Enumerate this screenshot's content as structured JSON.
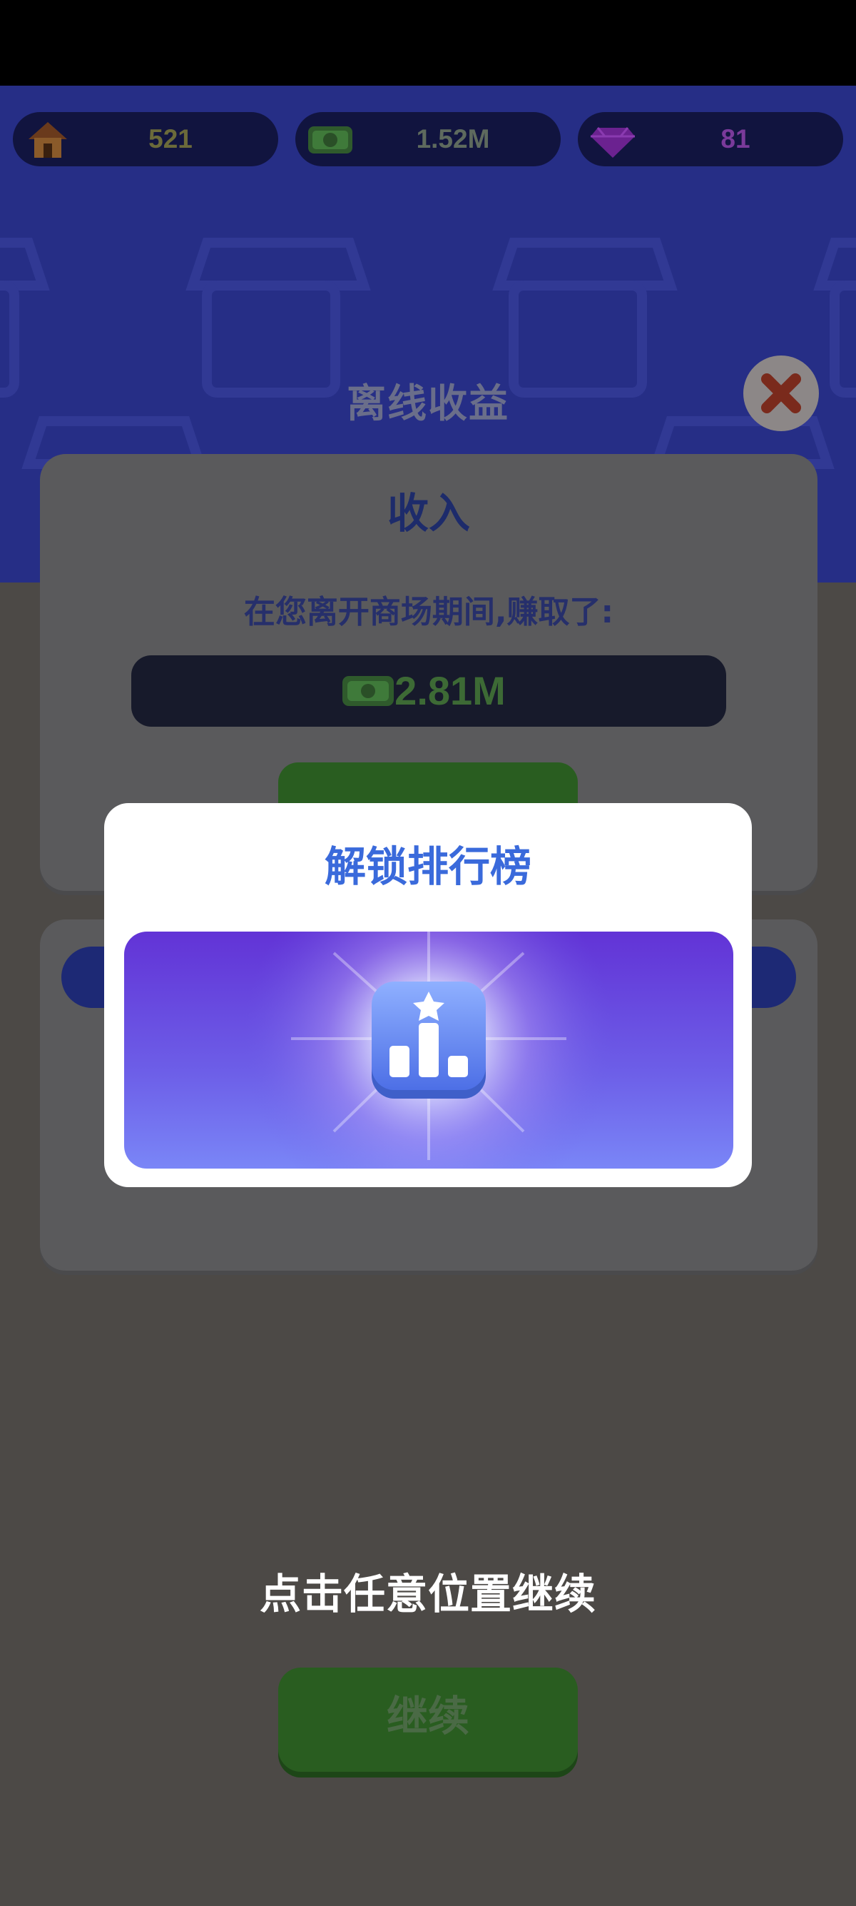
{
  "resources": [
    {
      "name": "stores",
      "value": "521",
      "icon": "house-icon",
      "color": "#6b6a3a"
    },
    {
      "name": "cash",
      "value": "1.52M",
      "icon": "cash-icon",
      "color": "#5e6a5e"
    },
    {
      "name": "gems",
      "value": "81",
      "icon": "diamond-icon",
      "color": "#6c3090"
    }
  ],
  "offline": {
    "title": "离线收益",
    "close_icon": "close-icon"
  },
  "income": {
    "title": "收入",
    "description": "在您离开商场期间,赚取了:",
    "amount": "2.81M",
    "amount_icon": "cash-icon"
  },
  "dialog": {
    "title": "解锁排行榜",
    "image_icon": "leaderboard-icon"
  },
  "footer": {
    "hint": "点击任意位置继续",
    "continue_label": "继续"
  },
  "colors": {
    "header_blue": "#262e86",
    "overlay": "#4c4946",
    "dialog_title": "#3a6adb",
    "button_green": "#295d20"
  }
}
